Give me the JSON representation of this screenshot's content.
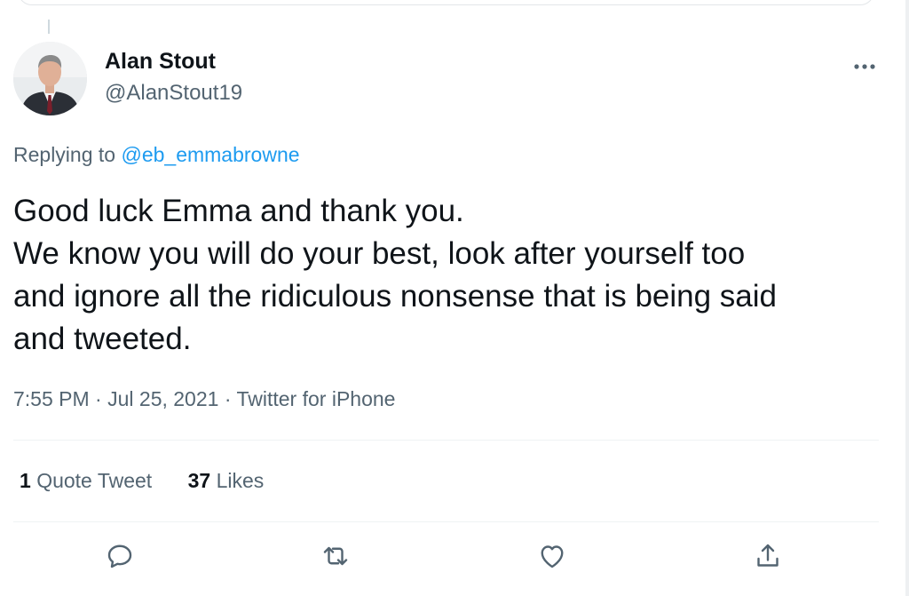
{
  "author": {
    "name": "Alan Stout",
    "handle": "@AlanStout19",
    "avatar_icon": "profile-photo"
  },
  "reply": {
    "prefix": "Replying to",
    "mention": "@eb_emmabrowne"
  },
  "tweet": {
    "lines": [
      "Good luck Emma and thank you.",
      "We know you will do your best, look after yourself too",
      "and ignore all the ridiculous nonsense that is being said",
      "and tweeted."
    ]
  },
  "meta": {
    "time": "7:55 PM",
    "separator": "·",
    "date": "Jul 25, 2021",
    "source": "Twitter for iPhone"
  },
  "stats": {
    "quote_count": "1",
    "quote_label": "Quote Tweet",
    "likes_count": "37",
    "likes_label": "Likes"
  },
  "actions": [
    {
      "icon": "reply-icon"
    },
    {
      "icon": "retweet-icon"
    },
    {
      "icon": "like-icon"
    },
    {
      "icon": "share-icon"
    }
  ],
  "colors": {
    "link": "#1d9bf0",
    "secondary_text": "#536471",
    "primary_text": "#0f1419"
  }
}
